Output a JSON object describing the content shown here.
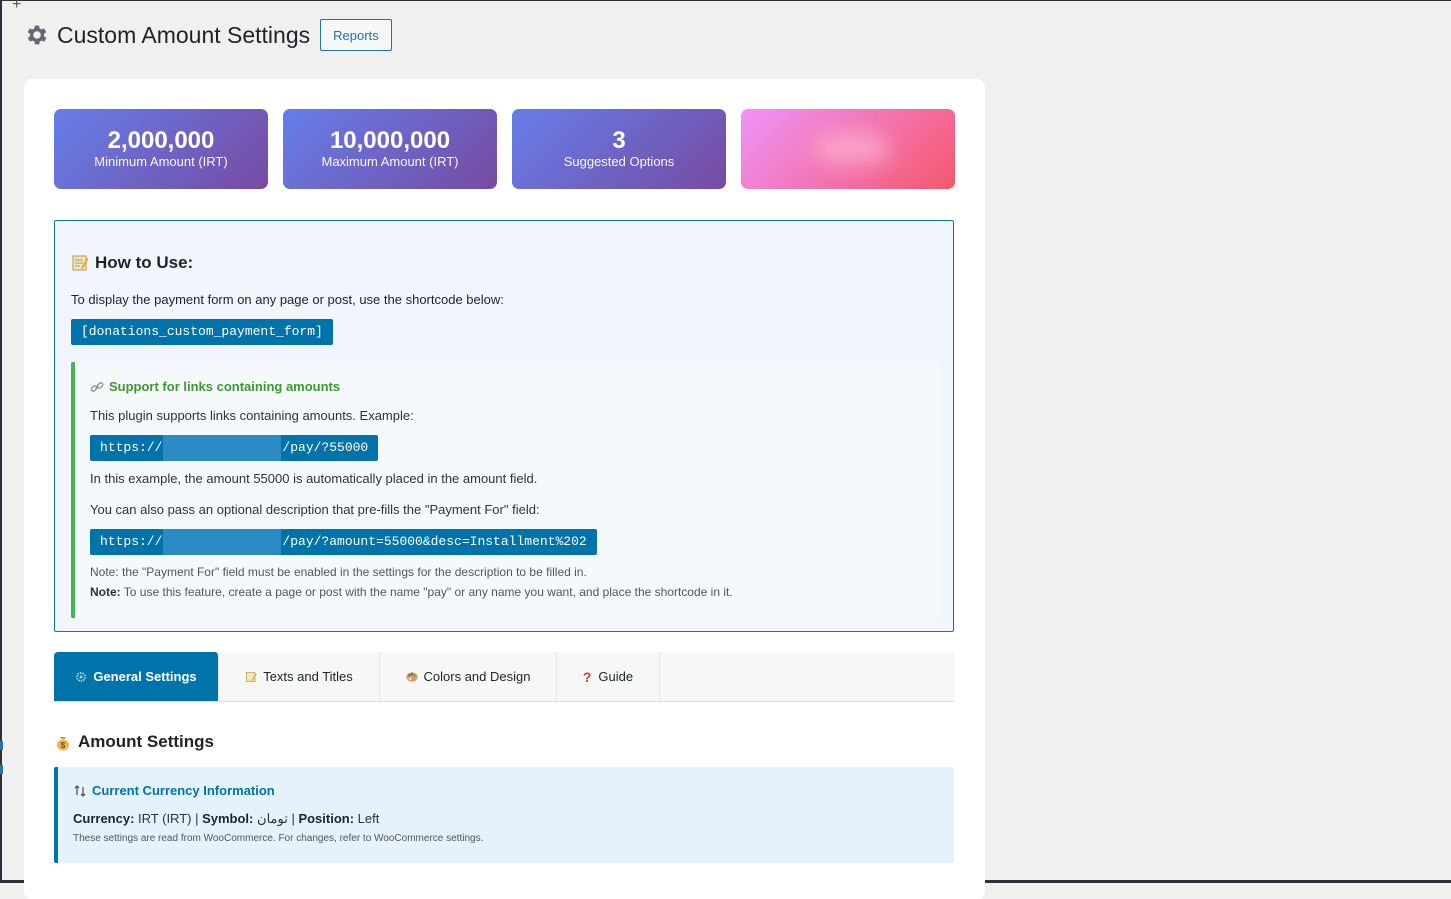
{
  "header": {
    "title": "Custom Amount Settings",
    "reports_label": "Reports"
  },
  "stats": [
    {
      "value": "2,000,000",
      "label": "Minimum Amount (IRT)"
    },
    {
      "value": "10,000,000",
      "label": "Maximum Amount (IRT)"
    },
    {
      "value": "3",
      "label": "Suggested Options"
    }
  ],
  "how_to_use": {
    "title": "How to Use:",
    "description": "To display the payment form on any page or post, use the shortcode below:",
    "shortcode": "[donations_custom_payment_form]",
    "links": {
      "title": "Support for links containing amounts",
      "intro": "This plugin supports links containing amounts. Example:",
      "example1_prefix": "https://",
      "example1_suffix": "/pay/?55000",
      "example1_note": "In this example, the amount 55000 is automatically placed in the amount field.",
      "example2_intro": "You can also pass an optional description that pre-fills the \"Payment For\" field:",
      "example2_prefix": "https://",
      "example2_suffix": "/pay/?amount=55000&desc=Installment%202",
      "note1": "Note: the \"Payment For\" field must be enabled in the settings for the description to be filled in.",
      "note2_label": "Note:",
      "note2_text": " To use this feature, create a page or post with the name \"pay\" or any name you want, and place the shortcode in it."
    }
  },
  "tabs": [
    {
      "label": "General Settings",
      "icon": "gear-icon",
      "active": true
    },
    {
      "label": "Texts and Titles",
      "icon": "memo-icon",
      "active": false
    },
    {
      "label": "Colors and Design",
      "icon": "palette-icon",
      "active": false
    },
    {
      "label": "Guide",
      "icon": "question-icon",
      "active": false
    }
  ],
  "amount_settings": {
    "title": "Amount Settings",
    "currency_title": "Current Currency Information",
    "currency_label": "Currency:",
    "currency_value": " IRT (IRT) | ",
    "symbol_label": "Symbol:",
    "symbol_value": " تومان | ",
    "position_label": "Position:",
    "position_value": " Left",
    "note": "These settings are read from WooCommerce. For changes, refer to WooCommerce settings."
  },
  "colors": {
    "accent": "#0073aa",
    "card_gradient_start": "#667eea",
    "card_gradient_end": "#764ba2",
    "pink_start": "#f093fb",
    "pink_end": "#f5576c",
    "success_green": "#46b450"
  }
}
